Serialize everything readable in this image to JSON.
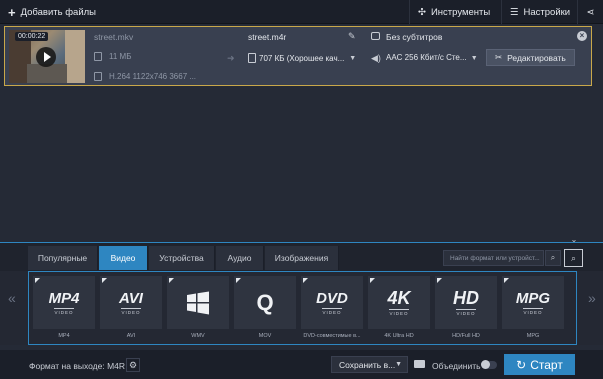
{
  "topbar": {
    "add_files": "Добавить файлы",
    "tools": "Инструменты",
    "settings": "Настройки"
  },
  "file": {
    "duration": "00:00:22",
    "source_name": "street.mkv",
    "size": "11 МБ",
    "codec": "H.264 1122x746 3667 ...",
    "output_name": "street.m4r",
    "output_format": "707 КБ (Хорошее кач...",
    "subtitles": "Без субтитров",
    "audio": "AAC 256 Кбит/с Сте...",
    "edit_label": "Редактировать"
  },
  "tabs": [
    {
      "label": "Популярные"
    },
    {
      "label": "Видео"
    },
    {
      "label": "Устройства"
    },
    {
      "label": "Аудио"
    },
    {
      "label": "Изображения"
    }
  ],
  "search": {
    "placeholder": "Найти формат или устройст..."
  },
  "formats": [
    {
      "logo": "MP4",
      "sub": "VIDEO",
      "label": "MP4"
    },
    {
      "logo": "AVI",
      "sub": "VIDEO",
      "label": "AVI"
    },
    {
      "logo": "",
      "sub": "",
      "label": "WMV"
    },
    {
      "logo": "Q",
      "sub": "",
      "label": "MOV"
    },
    {
      "logo": "DVD",
      "sub": "VIDEO",
      "label": "DVD-совместимые в..."
    },
    {
      "logo": "4K",
      "sub": "VIDEO",
      "label": "4K Ultra HD"
    },
    {
      "logo": "HD",
      "sub": "VIDEO",
      "label": "HD/Full HD"
    },
    {
      "logo": "MPG",
      "sub": "VIDEO",
      "label": "MPG"
    }
  ],
  "footer": {
    "output_format": "Формат на выходе: M4R",
    "save_to": "Сохранить в...",
    "merge": "Объединить",
    "start": "Старт"
  },
  "colors": {
    "accent": "#2e86c1",
    "selection_border": "#c9a84a"
  }
}
